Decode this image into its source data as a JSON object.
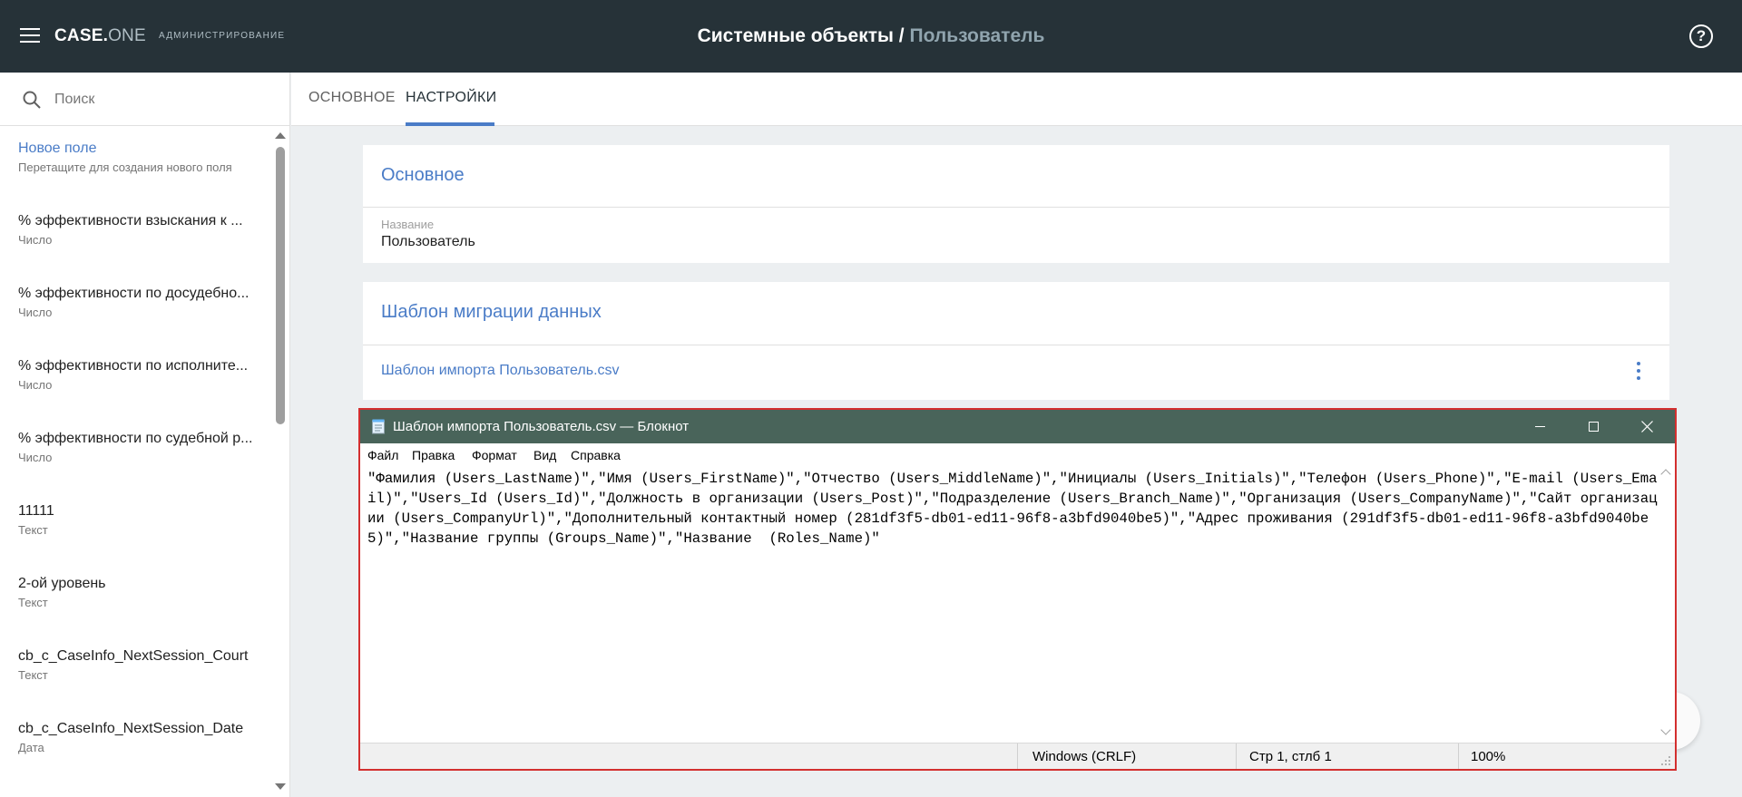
{
  "app": {
    "brand_main": "CASE.",
    "brand_suffix": "ONE",
    "section": "АДМИНИСТРИРОВАНИЕ",
    "title_main": "Системные объекты /",
    "title_sub": "Пользователь",
    "help_symbol": "?"
  },
  "search": {
    "placeholder": "Поиск"
  },
  "fields": [
    {
      "name": "Новое поле",
      "type": "Перетащите для создания нового поля"
    },
    {
      "name": "% эффективности взыскания к ...",
      "type": "Число"
    },
    {
      "name": "% эффективности по досудебно...",
      "type": "Число"
    },
    {
      "name": "% эффективности по исполните...",
      "type": "Число"
    },
    {
      "name": "% эффективности по судебной р...",
      "type": "Число"
    },
    {
      "name": "11111",
      "type": "Текст"
    },
    {
      "name": "2-ой уровень",
      "type": "Текст"
    },
    {
      "name": "cb_c_CaseInfo_NextSession_Court",
      "type": "Текст"
    },
    {
      "name": "cb_c_CaseInfo_NextSession_Date",
      "type": "Дата"
    }
  ],
  "tabs": {
    "basic": "ОСНОВНОЕ",
    "settings": "НАСТРОЙКИ",
    "active": "settings"
  },
  "basic_card": {
    "title": "Основное",
    "name_label": "Название",
    "name_value": "Пользователь"
  },
  "migration_card": {
    "title": "Шаблон миграции данных",
    "file_link": "Шаблон импорта Пользователь.csv"
  },
  "notepad": {
    "title": "Шаблон импорта Пользователь.csv — Блокнот",
    "menu": [
      "Файл",
      "Правка",
      "Формат",
      "Вид",
      "Справка"
    ],
    "content": "\"Фамилия (Users_LastName)\",\"Имя (Users_FirstName)\",\"Отчество (Users_MiddleName)\",\"Инициалы (Users_Initials)\",\"Телефон (Users_Phone)\",\"E-mail (Users_Email)\",\"Users_Id (Users_Id)\",\"Должность в организации (Users_Post)\",\"Подразделение (Users_Branch_Name)\",\"Организация (Users_CompanyName)\",\"Сайт организации (Users_CompanyUrl)\",\"Дополнительный контактный номер (281df3f5-db01-ed11-96f8-a3bfd9040be5)\",\"Адрес проживания (291df3f5-db01-ed11-96f8-a3bfd9040be5)\",\"Название группы (Groups_Name)\",\"Название  (Roles_Name)\"",
    "status": {
      "line_ending": "Windows (CRLF)",
      "position": "Стр 1, стлб 1",
      "zoom": "100%"
    }
  },
  "colors": {
    "header_bg": "#263238",
    "accent": "#4a7cc7",
    "notepad_titlebar": "#49645a",
    "highlight_border": "#d32f2f"
  }
}
